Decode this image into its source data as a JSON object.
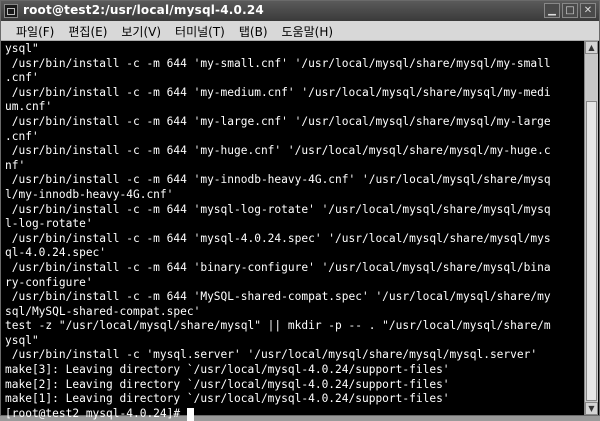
{
  "window": {
    "title": "root@test2:/usr/local/mysql-4.0.24"
  },
  "menu": [
    "파일(F)",
    "편집(E)",
    "보기(V)",
    "터미널(T)",
    "탭(B)",
    "도움말(H)"
  ],
  "terminal": {
    "lines": [
      "ysql\"",
      " /usr/bin/install -c -m 644 'my-small.cnf' '/usr/local/mysql/share/mysql/my-small",
      ".cnf'",
      " /usr/bin/install -c -m 644 'my-medium.cnf' '/usr/local/mysql/share/mysql/my-medi",
      "um.cnf'",
      " /usr/bin/install -c -m 644 'my-large.cnf' '/usr/local/mysql/share/mysql/my-large",
      ".cnf'",
      " /usr/bin/install -c -m 644 'my-huge.cnf' '/usr/local/mysql/share/mysql/my-huge.c",
      "nf'",
      " /usr/bin/install -c -m 644 'my-innodb-heavy-4G.cnf' '/usr/local/mysql/share/mysq",
      "l/my-innodb-heavy-4G.cnf'",
      " /usr/bin/install -c -m 644 'mysql-log-rotate' '/usr/local/mysql/share/mysql/mysq",
      "l-log-rotate'",
      " /usr/bin/install -c -m 644 'mysql-4.0.24.spec' '/usr/local/mysql/share/mysql/mys",
      "ql-4.0.24.spec'",
      " /usr/bin/install -c -m 644 'binary-configure' '/usr/local/mysql/share/mysql/bina",
      "ry-configure'",
      " /usr/bin/install -c -m 644 'MySQL-shared-compat.spec' '/usr/local/mysql/share/my",
      "sql/MySQL-shared-compat.spec'",
      "test -z \"/usr/local/mysql/share/mysql\" || mkdir -p -- . \"/usr/local/mysql/share/m",
      "ysql\"",
      " /usr/bin/install -c 'mysql.server' '/usr/local/mysql/share/mysql/mysql.server'",
      "make[3]: Leaving directory `/usr/local/mysql-4.0.24/support-files'",
      "make[2]: Leaving directory `/usr/local/mysql-4.0.24/support-files'",
      "make[1]: Leaving directory `/usr/local/mysql-4.0.24/support-files'"
    ],
    "prompt": "[root@test2 mysql-4.0.24]# "
  },
  "icons": {
    "app": "terminal-icon",
    "minimize": "minimize-icon",
    "maximize": "maximize-icon",
    "close": "close-icon"
  },
  "colors": {
    "terminal_bg": "#000000",
    "terminal_fg": "#ffffff",
    "menubar_bg": "#d8d8d8"
  }
}
